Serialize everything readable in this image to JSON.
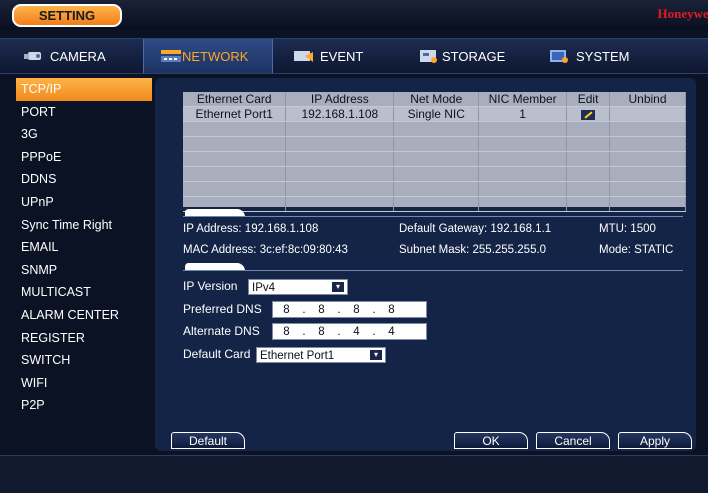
{
  "topbar": {
    "setting_label": "SETTING",
    "brand": "Honeywell"
  },
  "nav": {
    "tabs": [
      {
        "label": "CAMERA",
        "icon": "camera-icon"
      },
      {
        "label": "NETWORK",
        "icon": "network-icon",
        "active": true
      },
      {
        "label": "EVENT",
        "icon": "event-icon"
      },
      {
        "label": "STORAGE",
        "icon": "storage-icon"
      },
      {
        "label": "SYSTEM",
        "icon": "system-icon"
      }
    ]
  },
  "sidebar": {
    "items": [
      {
        "label": "TCP/IP",
        "active": true
      },
      {
        "label": "PORT"
      },
      {
        "label": "3G"
      },
      {
        "label": "PPPoE"
      },
      {
        "label": "DDNS"
      },
      {
        "label": "UPnP"
      },
      {
        "label": "Sync Time Right"
      },
      {
        "label": "EMAIL"
      },
      {
        "label": "SNMP"
      },
      {
        "label": "MULTICAST"
      },
      {
        "label": "ALARM CENTER"
      },
      {
        "label": "REGISTER"
      },
      {
        "label": "SWITCH"
      },
      {
        "label": "WIFI"
      },
      {
        "label": "P2P"
      }
    ]
  },
  "table": {
    "columns": [
      "Ethernet Card",
      "IP Address",
      "Net Mode",
      "NIC Member",
      "Edit",
      "Unbind"
    ],
    "rows": [
      {
        "card": "Ethernet Port1",
        "ip": "192.168.1.108",
        "mode": "Single NIC",
        "member": "1",
        "edit_icon": "edit-pencil-icon",
        "unbind": ""
      }
    ]
  },
  "info": {
    "ip_address": "IP Address: 192.168.1.108",
    "default_gateway": "Default Gateway: 192.168.1.1",
    "mtu": "MTU: 1500",
    "mac_address": "MAC Address: 3c:ef:8c:09:80:43",
    "subnet_mask": "Subnet Mask: 255.255.255.0",
    "mode": "Mode: STATIC"
  },
  "form": {
    "ip_version": {
      "label": "IP Version",
      "value": "IPv4"
    },
    "preferred_dns": {
      "label": "Preferred DNS",
      "octets": [
        "8",
        "8",
        "8",
        "8"
      ]
    },
    "alternate_dns": {
      "label": "Alternate DNS",
      "octets": [
        "8",
        "8",
        "4",
        "4"
      ]
    },
    "default_card": {
      "label": "Default Card",
      "value": "Ethernet Port1"
    },
    "dot": "."
  },
  "buttons": {
    "default": "Default",
    "ok": "OK",
    "cancel": "Cancel",
    "apply": "Apply"
  },
  "colors": {
    "accent": "#f39a2c",
    "brand": "#e21b23",
    "panel": "#142447",
    "background": "#0b1224"
  }
}
